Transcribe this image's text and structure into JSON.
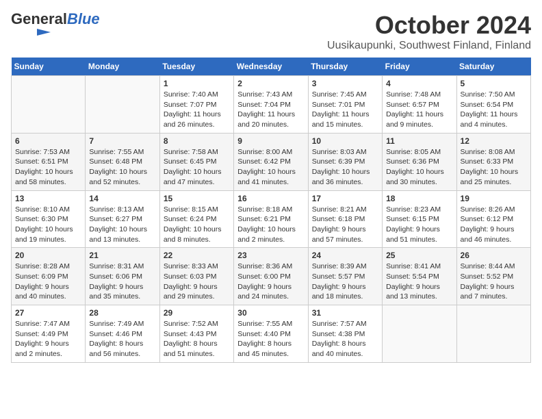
{
  "header": {
    "logo_general": "General",
    "logo_blue": "Blue",
    "month_title": "October 2024",
    "location": "Uusikaupunki, Southwest Finland, Finland"
  },
  "weekdays": [
    "Sunday",
    "Monday",
    "Tuesday",
    "Wednesday",
    "Thursday",
    "Friday",
    "Saturday"
  ],
  "weeks": [
    [
      {
        "day": "",
        "sunrise": "",
        "sunset": "",
        "daylight": ""
      },
      {
        "day": "",
        "sunrise": "",
        "sunset": "",
        "daylight": ""
      },
      {
        "day": "1",
        "sunrise": "Sunrise: 7:40 AM",
        "sunset": "Sunset: 7:07 PM",
        "daylight": "Daylight: 11 hours and 26 minutes."
      },
      {
        "day": "2",
        "sunrise": "Sunrise: 7:43 AM",
        "sunset": "Sunset: 7:04 PM",
        "daylight": "Daylight: 11 hours and 20 minutes."
      },
      {
        "day": "3",
        "sunrise": "Sunrise: 7:45 AM",
        "sunset": "Sunset: 7:01 PM",
        "daylight": "Daylight: 11 hours and 15 minutes."
      },
      {
        "day": "4",
        "sunrise": "Sunrise: 7:48 AM",
        "sunset": "Sunset: 6:57 PM",
        "daylight": "Daylight: 11 hours and 9 minutes."
      },
      {
        "day": "5",
        "sunrise": "Sunrise: 7:50 AM",
        "sunset": "Sunset: 6:54 PM",
        "daylight": "Daylight: 11 hours and 4 minutes."
      }
    ],
    [
      {
        "day": "6",
        "sunrise": "Sunrise: 7:53 AM",
        "sunset": "Sunset: 6:51 PM",
        "daylight": "Daylight: 10 hours and 58 minutes."
      },
      {
        "day": "7",
        "sunrise": "Sunrise: 7:55 AM",
        "sunset": "Sunset: 6:48 PM",
        "daylight": "Daylight: 10 hours and 52 minutes."
      },
      {
        "day": "8",
        "sunrise": "Sunrise: 7:58 AM",
        "sunset": "Sunset: 6:45 PM",
        "daylight": "Daylight: 10 hours and 47 minutes."
      },
      {
        "day": "9",
        "sunrise": "Sunrise: 8:00 AM",
        "sunset": "Sunset: 6:42 PM",
        "daylight": "Daylight: 10 hours and 41 minutes."
      },
      {
        "day": "10",
        "sunrise": "Sunrise: 8:03 AM",
        "sunset": "Sunset: 6:39 PM",
        "daylight": "Daylight: 10 hours and 36 minutes."
      },
      {
        "day": "11",
        "sunrise": "Sunrise: 8:05 AM",
        "sunset": "Sunset: 6:36 PM",
        "daylight": "Daylight: 10 hours and 30 minutes."
      },
      {
        "day": "12",
        "sunrise": "Sunrise: 8:08 AM",
        "sunset": "Sunset: 6:33 PM",
        "daylight": "Daylight: 10 hours and 25 minutes."
      }
    ],
    [
      {
        "day": "13",
        "sunrise": "Sunrise: 8:10 AM",
        "sunset": "Sunset: 6:30 PM",
        "daylight": "Daylight: 10 hours and 19 minutes."
      },
      {
        "day": "14",
        "sunrise": "Sunrise: 8:13 AM",
        "sunset": "Sunset: 6:27 PM",
        "daylight": "Daylight: 10 hours and 13 minutes."
      },
      {
        "day": "15",
        "sunrise": "Sunrise: 8:15 AM",
        "sunset": "Sunset: 6:24 PM",
        "daylight": "Daylight: 10 hours and 8 minutes."
      },
      {
        "day": "16",
        "sunrise": "Sunrise: 8:18 AM",
        "sunset": "Sunset: 6:21 PM",
        "daylight": "Daylight: 10 hours and 2 minutes."
      },
      {
        "day": "17",
        "sunrise": "Sunrise: 8:21 AM",
        "sunset": "Sunset: 6:18 PM",
        "daylight": "Daylight: 9 hours and 57 minutes."
      },
      {
        "day": "18",
        "sunrise": "Sunrise: 8:23 AM",
        "sunset": "Sunset: 6:15 PM",
        "daylight": "Daylight: 9 hours and 51 minutes."
      },
      {
        "day": "19",
        "sunrise": "Sunrise: 8:26 AM",
        "sunset": "Sunset: 6:12 PM",
        "daylight": "Daylight: 9 hours and 46 minutes."
      }
    ],
    [
      {
        "day": "20",
        "sunrise": "Sunrise: 8:28 AM",
        "sunset": "Sunset: 6:09 PM",
        "daylight": "Daylight: 9 hours and 40 minutes."
      },
      {
        "day": "21",
        "sunrise": "Sunrise: 8:31 AM",
        "sunset": "Sunset: 6:06 PM",
        "daylight": "Daylight: 9 hours and 35 minutes."
      },
      {
        "day": "22",
        "sunrise": "Sunrise: 8:33 AM",
        "sunset": "Sunset: 6:03 PM",
        "daylight": "Daylight: 9 hours and 29 minutes."
      },
      {
        "day": "23",
        "sunrise": "Sunrise: 8:36 AM",
        "sunset": "Sunset: 6:00 PM",
        "daylight": "Daylight: 9 hours and 24 minutes."
      },
      {
        "day": "24",
        "sunrise": "Sunrise: 8:39 AM",
        "sunset": "Sunset: 5:57 PM",
        "daylight": "Daylight: 9 hours and 18 minutes."
      },
      {
        "day": "25",
        "sunrise": "Sunrise: 8:41 AM",
        "sunset": "Sunset: 5:54 PM",
        "daylight": "Daylight: 9 hours and 13 minutes."
      },
      {
        "day": "26",
        "sunrise": "Sunrise: 8:44 AM",
        "sunset": "Sunset: 5:52 PM",
        "daylight": "Daylight: 9 hours and 7 minutes."
      }
    ],
    [
      {
        "day": "27",
        "sunrise": "Sunrise: 7:47 AM",
        "sunset": "Sunset: 4:49 PM",
        "daylight": "Daylight: 9 hours and 2 minutes."
      },
      {
        "day": "28",
        "sunrise": "Sunrise: 7:49 AM",
        "sunset": "Sunset: 4:46 PM",
        "daylight": "Daylight: 8 hours and 56 minutes."
      },
      {
        "day": "29",
        "sunrise": "Sunrise: 7:52 AM",
        "sunset": "Sunset: 4:43 PM",
        "daylight": "Daylight: 8 hours and 51 minutes."
      },
      {
        "day": "30",
        "sunrise": "Sunrise: 7:55 AM",
        "sunset": "Sunset: 4:40 PM",
        "daylight": "Daylight: 8 hours and 45 minutes."
      },
      {
        "day": "31",
        "sunrise": "Sunrise: 7:57 AM",
        "sunset": "Sunset: 4:38 PM",
        "daylight": "Daylight: 8 hours and 40 minutes."
      },
      {
        "day": "",
        "sunrise": "",
        "sunset": "",
        "daylight": ""
      },
      {
        "day": "",
        "sunrise": "",
        "sunset": "",
        "daylight": ""
      }
    ]
  ]
}
